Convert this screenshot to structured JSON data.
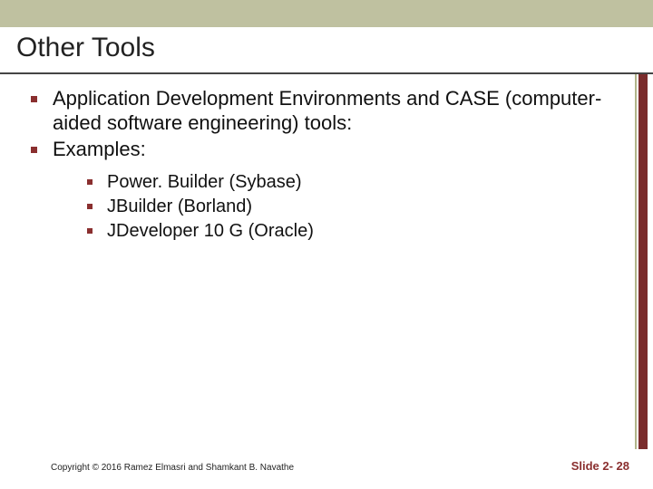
{
  "title": "Other Tools",
  "bullets": {
    "level1": [
      {
        "text": "Application Development Environments and CASE (computer-aided software engineering) tools:"
      },
      {
        "text": "Examples:"
      }
    ],
    "level2": [
      {
        "text": "Power. Builder (Sybase)"
      },
      {
        "text": "JBuilder (Borland)"
      },
      {
        "text": "JDeveloper 10 G (Oracle)"
      }
    ]
  },
  "footer": {
    "copyright": "Copyright © 2016 Ramez Elmasri and Shamkant B. Navathe",
    "slide_number": "Slide 2- 28"
  },
  "colors": {
    "accent": "#8a2f2f",
    "top_bar": "#bfc1a0"
  }
}
